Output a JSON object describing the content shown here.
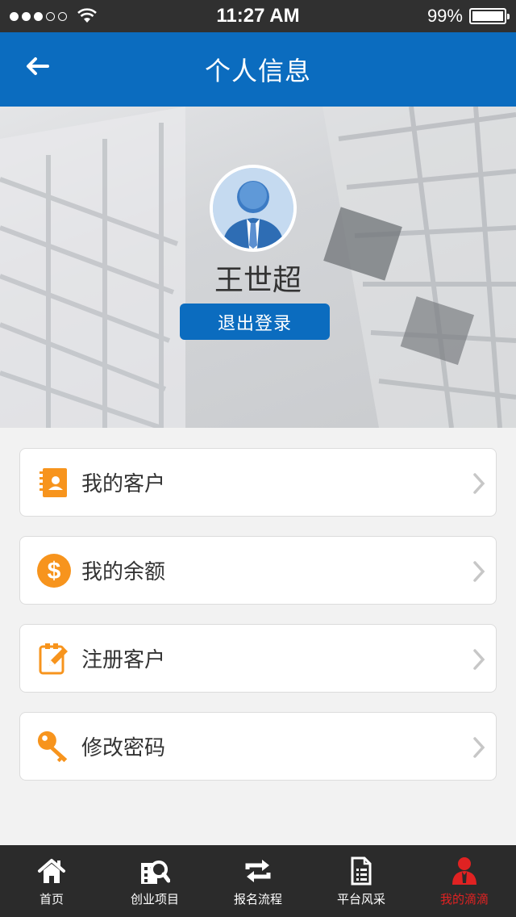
{
  "status_bar": {
    "time": "11:27 AM",
    "battery": "99%"
  },
  "nav": {
    "title": "个人信息"
  },
  "profile": {
    "name": "王世超",
    "logout_label": "退出登录"
  },
  "menu": [
    {
      "label": "我的客户",
      "icon": "contacts-book-icon"
    },
    {
      "label": "我的余额",
      "icon": "dollar-coin-icon"
    },
    {
      "label": "注册客户",
      "icon": "edit-form-icon"
    },
    {
      "label": "修改密码",
      "icon": "key-icon"
    }
  ],
  "tabs": [
    {
      "label": "首页",
      "icon": "home-icon"
    },
    {
      "label": "创业项目",
      "icon": "building-search-icon"
    },
    {
      "label": "报名流程",
      "icon": "refresh-arrows-icon"
    },
    {
      "label": "平台风采",
      "icon": "document-icon"
    },
    {
      "label": "我的滴滴",
      "icon": "user-icon"
    }
  ],
  "colors": {
    "accent": "#0b6cbf",
    "icon_orange": "#f7941d",
    "active_tab": "#e02222",
    "tab_bar": "#2b2b2b"
  }
}
